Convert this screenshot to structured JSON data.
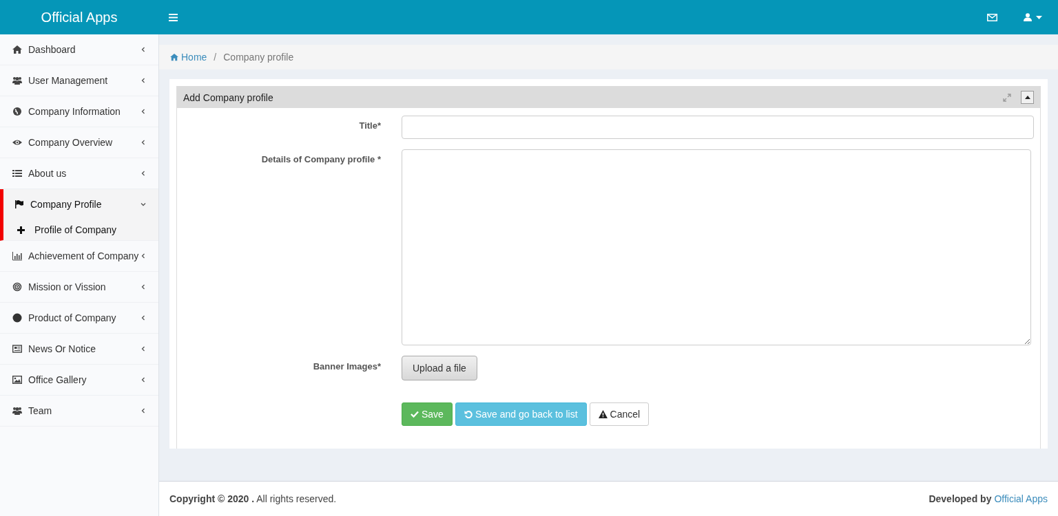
{
  "header": {
    "brand": "Official Apps"
  },
  "sidebar": {
    "items": [
      {
        "label": "Dashboard",
        "expanded": false,
        "selected": false
      },
      {
        "label": "User Management",
        "expanded": false,
        "selected": false
      },
      {
        "label": "Company Information",
        "expanded": false,
        "selected": false
      },
      {
        "label": "Company Overview",
        "expanded": false,
        "selected": false
      },
      {
        "label": "About us",
        "expanded": false,
        "selected": false
      },
      {
        "label": "Company Profile",
        "expanded": true,
        "selected": true,
        "children": [
          {
            "label": "Profile of Company",
            "selected": true
          }
        ]
      },
      {
        "label": "Achievement of Company",
        "expanded": false,
        "selected": false
      },
      {
        "label": "Mission or Vission",
        "expanded": false,
        "selected": false
      },
      {
        "label": "Product of Company",
        "expanded": false,
        "selected": false
      },
      {
        "label": "News Or Notice",
        "expanded": false,
        "selected": false
      },
      {
        "label": "Office Gallery",
        "expanded": false,
        "selected": false
      },
      {
        "label": "Team",
        "expanded": false,
        "selected": false
      }
    ]
  },
  "breadcrumb": [
    {
      "label": "Home"
    },
    {
      "label": "Company profile"
    }
  ],
  "breadcrumb_separator": "/",
  "panel": {
    "title": "Add Company profile",
    "fields": [
      {
        "kind": "text",
        "label": "Title*"
      },
      {
        "kind": "textarea",
        "label": "Details of Company profile *"
      },
      {
        "kind": "file",
        "label": "Banner Images*",
        "button": "Upload a file"
      }
    ],
    "buttons": [
      {
        "kind": "save",
        "label": "Save"
      },
      {
        "kind": "back",
        "label": "Save and go back to list"
      },
      {
        "kind": "cancel",
        "label": "Cancel"
      }
    ]
  },
  "footer": {
    "copyright": "**Copyright © 2020 .** All rights reserved.",
    "developed_by": "Developed by",
    "developer": "Official Apps"
  }
}
